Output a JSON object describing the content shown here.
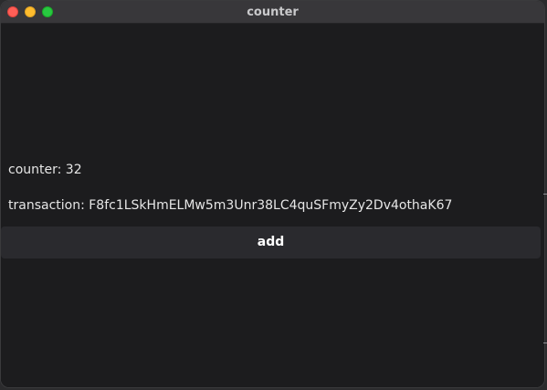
{
  "window": {
    "title": "counter"
  },
  "content": {
    "counter_label": "counter: 32",
    "transaction_label": "transaction: F8fc1LSkHmELMw5m3Unr38LC4quSFmyZy2Dv4othaK67",
    "add_button_label": "add"
  },
  "colors": {
    "background": "#1c1c1e",
    "titlebar": "#38373a",
    "button": "#2a2a2e",
    "text": "#e6e6e6",
    "traffic_close": "#ff5f57",
    "traffic_minimize": "#febc2e",
    "traffic_zoom": "#28c840"
  },
  "icons": {
    "close": "close-icon",
    "minimize": "minimize-icon",
    "zoom": "zoom-icon"
  }
}
